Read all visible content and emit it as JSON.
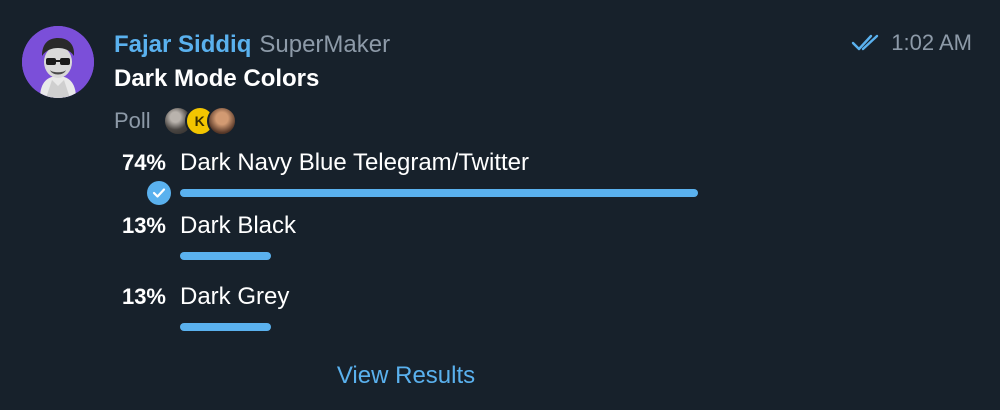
{
  "message": {
    "sender_name": "Fajar Siddiq",
    "sender_rank": "SuperMaker",
    "time": "1:02 AM",
    "status_icon": "double-check-icon"
  },
  "poll": {
    "question": "Dark Mode Colors",
    "type_label": "Poll",
    "voter_avatars": [
      "avatar",
      "K",
      "avatar"
    ],
    "options": [
      {
        "percent": "74%",
        "value": 0.74,
        "text": "Dark Navy Blue Telegram/Twitter",
        "chosen": true
      },
      {
        "percent": "13%",
        "value": 0.13,
        "text": "Dark Black",
        "chosen": false
      },
      {
        "percent": "13%",
        "value": 0.13,
        "text": "Dark Grey",
        "chosen": false
      }
    ],
    "view_results_label": "View Results"
  },
  "colors": {
    "background": "#17212b",
    "accent": "#5ab1ee",
    "muted": "#8d9aa8",
    "avatar_bg": "#7b4fd9"
  }
}
